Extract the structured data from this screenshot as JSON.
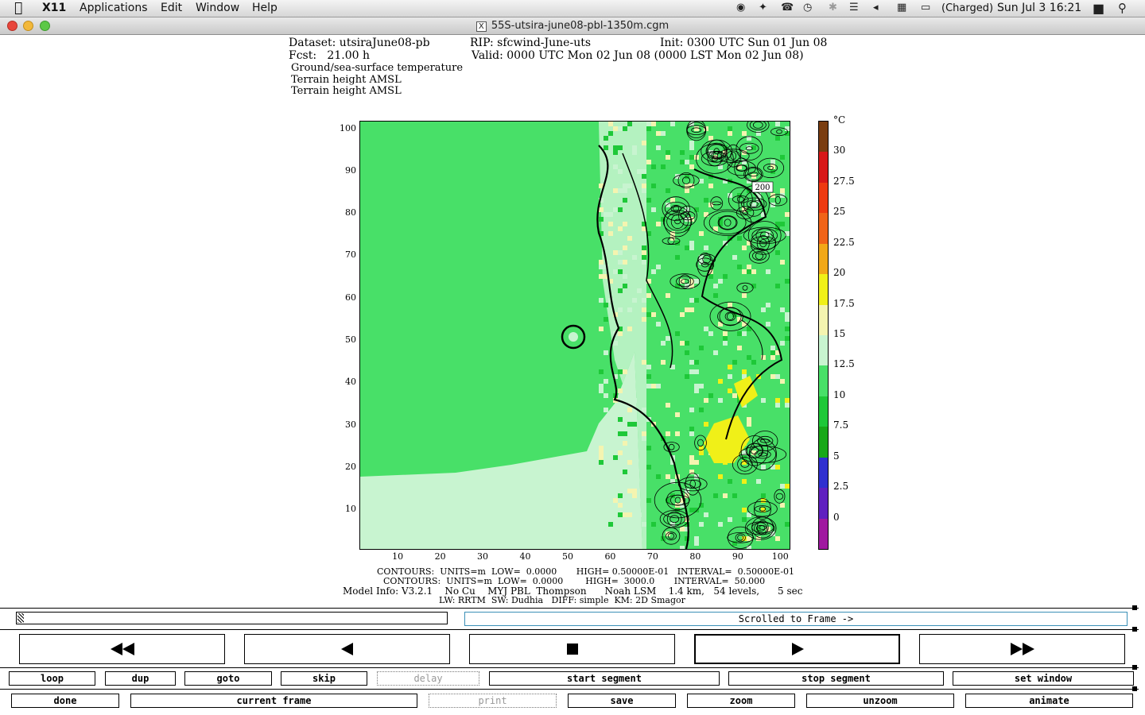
{
  "menubar": {
    "app": "X11",
    "items": [
      "Applications",
      "Edit",
      "Window",
      "Help"
    ],
    "battery": "(Charged)",
    "clock": "Sun Jul 3  16:21"
  },
  "window": {
    "title": "55S-utsira-june08-pbl-1350m.cgm"
  },
  "header": {
    "line1_left": "Dataset: utsiraJune08-pb",
    "line1_mid": "RIP: sfcwind-June-uts",
    "line1_right": "Init: 0300 UTC Sun 01 Jun 08",
    "line2_left": "Fcst:   21.00 h",
    "line2_right": "Valid: 0000 UTC Mon 02 Jun 08 (0000 LST Mon 02 Jun 08)",
    "field1": "Ground/sea-surface temperature",
    "field2": "Terrain height AMSL",
    "field3": "Terrain height AMSL"
  },
  "chart_data": {
    "type": "heatmap",
    "xlim": [
      1,
      102
    ],
    "ylim": [
      1,
      102
    ],
    "x_ticks": [
      "10",
      "20",
      "30",
      "40",
      "50",
      "60",
      "70",
      "80",
      "90",
      "100"
    ],
    "y_ticks": [
      "10",
      "20",
      "30",
      "40",
      "50",
      "60",
      "70",
      "80",
      "90",
      "100"
    ],
    "contour_label": "200",
    "colorbar": {
      "unit": "°C",
      "labels": [
        "30",
        "27.5",
        "25",
        "22.5",
        "20",
        "17.5",
        "15",
        "12.5",
        "10",
        "7.5",
        "5",
        "2.5",
        "0"
      ],
      "colors": [
        "#7a3d10",
        "#d81818",
        "#ee3a10",
        "#f06418",
        "#f2a818",
        "#f0f018",
        "#f4f4b0",
        "#c8f4d0",
        "#48e068",
        "#1ec838",
        "#18a818",
        "#3030d0",
        "#6020c0",
        "#a018a0"
      ]
    }
  },
  "footer": {
    "line1": "CONTOURS:  UNITS=m  LOW=  0.0000       HIGH= 0.50000E-01   INTERVAL=  0.50000E-01",
    "line2": "CONTOURS:  UNITS=m  LOW=  0.0000        HIGH=  3000.0       INTERVAL=  50.000",
    "line3": "Model Info: V3.2.1    No Cu    MYJ PBL  Thompson      Noah LSM    1.4 km,   54 levels,      5 sec",
    "line4": "LW: RRTM  SW: Dudhia   DIFF: simple  KM: 2D Smagor"
  },
  "controls": {
    "status": "Scrolled to Frame ->",
    "row1": [
      "loop",
      "dup",
      "goto",
      "skip",
      "delay",
      "start segment",
      "stop segment",
      "set window"
    ],
    "row2": [
      "done",
      "current frame",
      "print",
      "save",
      "zoom",
      "unzoom",
      "animate"
    ]
  }
}
